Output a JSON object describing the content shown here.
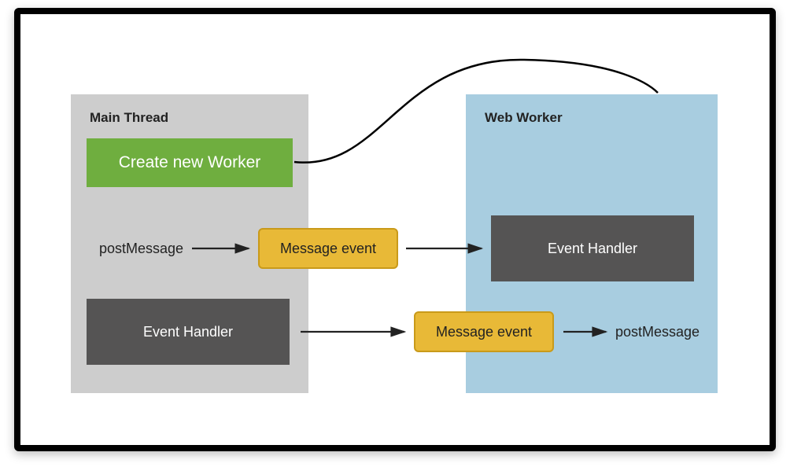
{
  "main_thread": {
    "title": "Main Thread",
    "create_label": "Create new Worker",
    "post_message_label": "postMessage",
    "event_handler_label": "Event Handler"
  },
  "web_worker": {
    "title": "Web Worker",
    "event_handler_label": "Event Handler",
    "post_message_label": "postMessage"
  },
  "messages": {
    "event1": "Message event",
    "event2": "Message event"
  },
  "colors": {
    "panel_main": "#cdcdcd",
    "panel_worker": "#a8cde0",
    "create_box": "#6fae3f",
    "message_box": "#e8b937",
    "handler_box": "#555454",
    "border": "#000000"
  }
}
